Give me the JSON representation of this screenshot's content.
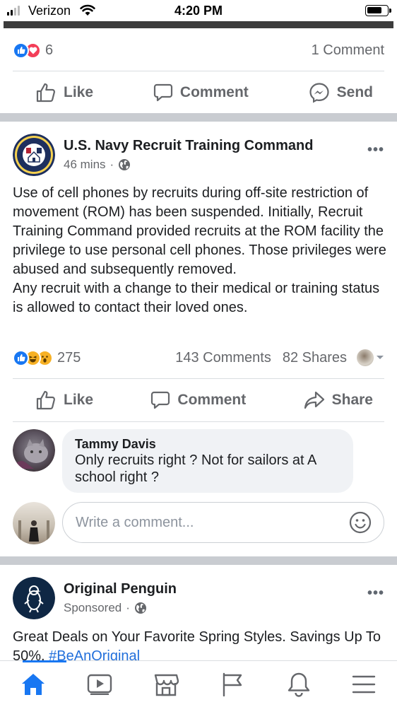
{
  "status_bar": {
    "carrier": "Verizon",
    "time": "4:20 PM"
  },
  "previous_post": {
    "reaction_count": "6",
    "comments": "1 Comment",
    "actions": {
      "like": "Like",
      "comment": "Comment",
      "send": "Send"
    }
  },
  "post": {
    "author": "U.S. Navy Recruit Training Command",
    "time": "46 mins",
    "separator": "·",
    "paragraph_1": "Use of cell phones by recruits during off-site restriction of movement (ROM) has been suspended. Initially, Recruit Training Command provided recruits at the ROM facility the privilege to use personal cell phones. Those privileges were abused and subsequently removed.",
    "paragraph_2": "Any recruit with a change to their medical or training status is allowed to contact their loved ones.",
    "reaction_count": "275",
    "comments": "143 Comments",
    "shares": "82 Shares",
    "actions": {
      "like": "Like",
      "comment": "Comment",
      "share": "Share"
    },
    "more": "•••"
  },
  "comment": {
    "author": "Tammy Davis",
    "text": "Only recruits right ? Not for sailors at A school right ?"
  },
  "composer": {
    "placeholder": "Write a comment..."
  },
  "sponsored_post": {
    "author": "Original Penguin",
    "label": "Sponsored",
    "separator": "·",
    "text": "Great Deals on Your Favorite Spring Styles. Savings Up To 50%.",
    "hashtag": "#BeAnOriginal",
    "more": "•••"
  },
  "colors": {
    "accent": "#1877f2",
    "love": "#f33e58",
    "haha": "#f7b125",
    "divider": "#c9ccd1",
    "secondary_text": "#65676b"
  },
  "icons": {
    "nav": [
      "home-icon",
      "watch-icon",
      "marketplace-icon",
      "pages-flag-icon",
      "notifications-icon",
      "menu-icon"
    ]
  }
}
